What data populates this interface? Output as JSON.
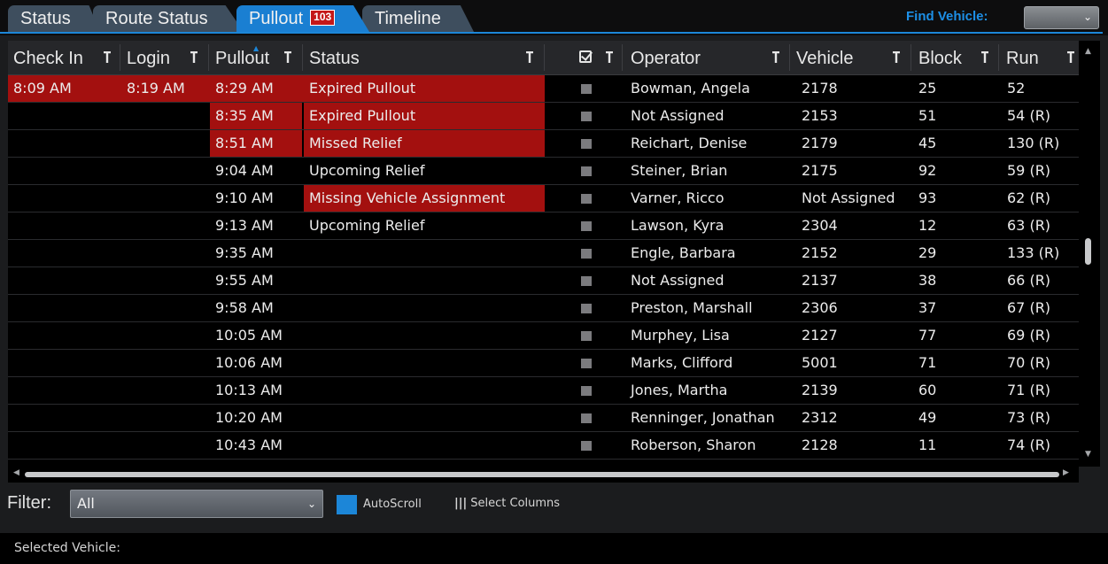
{
  "tabs": [
    {
      "label": "Status"
    },
    {
      "label": "Route Status"
    },
    {
      "label": "Pullout",
      "badge": "103",
      "active": true
    },
    {
      "label": "Timeline"
    }
  ],
  "find_vehicle": {
    "label": "Find Vehicle:",
    "value": ""
  },
  "columns": {
    "check_in": "Check In",
    "login": "Login",
    "pullout": "Pullout",
    "status": "Status",
    "operator": "Operator",
    "vehicle": "Vehicle",
    "block": "Block",
    "run": "Run"
  },
  "rows": [
    {
      "check_in": "8:09 AM",
      "login": "8:19 AM",
      "pullout": "8:29 AM",
      "status": "Expired Pullout",
      "operator": "Bowman, Angela",
      "vehicle": "2178",
      "block": "25",
      "run": "52"
    },
    {
      "check_in": "",
      "login": "",
      "pullout": "8:35 AM",
      "status": "Expired Pullout",
      "operator": "Not Assigned",
      "vehicle": "2153",
      "block": "51",
      "run": "54 (R)"
    },
    {
      "check_in": "",
      "login": "",
      "pullout": "8:51 AM",
      "status": "Missed Relief",
      "operator": "Reichart, Denise",
      "vehicle": "2179",
      "block": "45",
      "run": "130 (R)"
    },
    {
      "check_in": "",
      "login": "",
      "pullout": "9:04 AM",
      "status": "Upcoming Relief",
      "operator": "Steiner, Brian",
      "vehicle": "2175",
      "block": "92",
      "run": "59 (R)"
    },
    {
      "check_in": "",
      "login": "",
      "pullout": "9:10 AM",
      "status": "Missing Vehicle Assignment",
      "operator": "Varner, Ricco",
      "vehicle": "Not Assigned",
      "block": "93",
      "run": "62 (R)"
    },
    {
      "check_in": "",
      "login": "",
      "pullout": "9:13 AM",
      "status": "Upcoming Relief",
      "operator": "Lawson, Kyra",
      "vehicle": "2304",
      "block": "12",
      "run": "63 (R)"
    },
    {
      "check_in": "",
      "login": "",
      "pullout": "9:35 AM",
      "status": "",
      "operator": "Engle, Barbara",
      "vehicle": "2152",
      "block": "29",
      "run": "133 (R)"
    },
    {
      "check_in": "",
      "login": "",
      "pullout": "9:55 AM",
      "status": "",
      "operator": "Not Assigned",
      "vehicle": "2137",
      "block": "38",
      "run": "66 (R)"
    },
    {
      "check_in": "",
      "login": "",
      "pullout": "9:58 AM",
      "status": "",
      "operator": "Preston, Marshall",
      "vehicle": "2306",
      "block": "37",
      "run": "67 (R)"
    },
    {
      "check_in": "",
      "login": "",
      "pullout": "10:05 AM",
      "status": "",
      "operator": "Murphey, Lisa",
      "vehicle": "2127",
      "block": "77",
      "run": "69 (R)"
    },
    {
      "check_in": "",
      "login": "",
      "pullout": "10:06 AM",
      "status": "",
      "operator": "Marks, Clifford",
      "vehicle": "5001",
      "block": "71",
      "run": "70 (R)"
    },
    {
      "check_in": "",
      "login": "",
      "pullout": "10:13 AM",
      "status": "",
      "operator": "Jones, Martha",
      "vehicle": "2139",
      "block": "60",
      "run": "71 (R)"
    },
    {
      "check_in": "",
      "login": "",
      "pullout": "10:20 AM",
      "status": "",
      "operator": "Renninger, Jonathan",
      "vehicle": "2312",
      "block": "49",
      "run": "73 (R)"
    },
    {
      "check_in": "",
      "login": "",
      "pullout": "10:43 AM",
      "status": "",
      "operator": "Roberson, Sharon",
      "vehicle": "2128",
      "block": "11",
      "run": "74 (R)"
    }
  ],
  "filter": {
    "label": "Filter:",
    "value": "All"
  },
  "autoscroll": {
    "label": "AutoScroll",
    "checked": true
  },
  "select_columns": {
    "label": "Select Columns"
  },
  "status_bar": {
    "selected_vehicle_label": "Selected Vehicle:"
  },
  "colors": {
    "accent": "#1c86d8",
    "alert_red": "#a3100f",
    "badge_red": "#c41818"
  }
}
